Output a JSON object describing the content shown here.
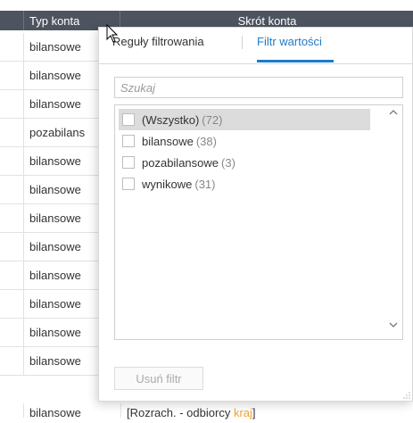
{
  "grid": {
    "columns": [
      "",
      "Typ konta",
      "Skrót konta"
    ],
    "rows": [
      "bilansowe",
      "bilansowe",
      "bilansowe",
      "pozabilans",
      "bilansowe",
      "bilansowe",
      "bilansowe",
      "bilansowe",
      "bilansowe",
      "bilansowe",
      "bilansowe",
      "bilansowe"
    ],
    "bottom_row": {
      "type": "bilansowe",
      "text_prefix": "[Rozrach. - odbiorcy ",
      "text_highlight": "kraj",
      "text_suffix": "]"
    }
  },
  "filter_popup": {
    "tabs": [
      "Reguły filtrowania",
      "Filtr wartości"
    ],
    "active_tab": "Filtr wartości",
    "search_placeholder": "Szukaj",
    "items": [
      {
        "label": "(Wszystko)",
        "count": "(72)",
        "checked": false,
        "selected": true
      },
      {
        "label": "bilansowe",
        "count": "(38)",
        "checked": false,
        "selected": false
      },
      {
        "label": "pozabilansowe",
        "count": "(3)",
        "checked": false,
        "selected": false
      },
      {
        "label": "wynikowe",
        "count": "(31)",
        "checked": false,
        "selected": false
      }
    ],
    "clear_button": "Usuń filtr",
    "scroll_up_icon": "chevron-up-icon",
    "scroll_down_icon": "chevron-down-icon"
  },
  "colors": {
    "header_bg": "#4d5460",
    "accent": "#1e7bc8",
    "selected_item_bg": "#dcdcdc",
    "highlight_text": "#f0a030"
  }
}
